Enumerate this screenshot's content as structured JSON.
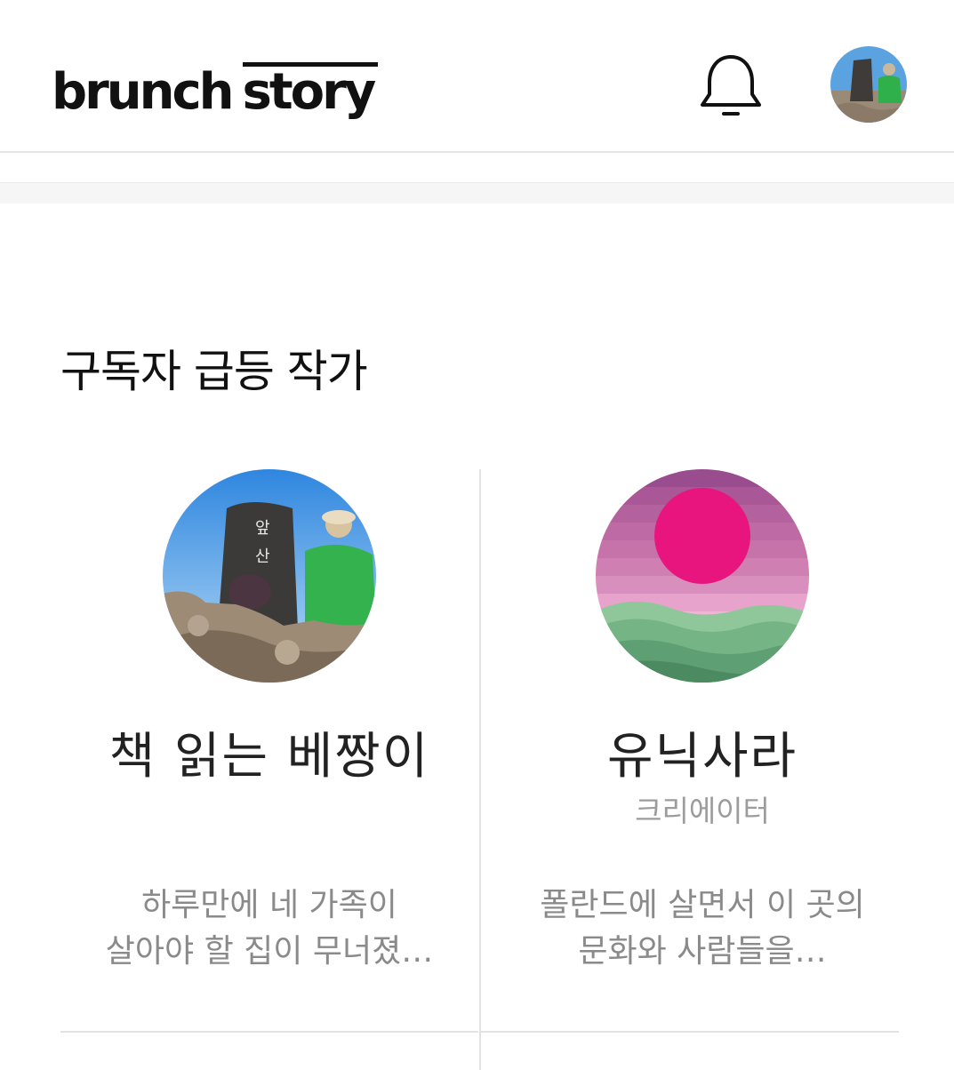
{
  "header": {
    "logo_brunch": "brunch",
    "logo_story": "story",
    "notifications_icon": "bell-icon",
    "profile_avatar": "user-avatar"
  },
  "section": {
    "title": "구독자 급등 작가"
  },
  "writers": [
    {
      "name": "책 읽는 베짱이",
      "role": "",
      "desc_line1": "하루만에 네 가족이",
      "desc_line2": "살아야 할 집이 무너졌…"
    },
    {
      "name": "유닉사라",
      "role": "크리에이터",
      "desc_line1": "폴란드에 살면서 이 곳의",
      "desc_line2": "문화와 사람들을…"
    }
  ],
  "colors": {
    "text_primary": "#111111",
    "text_secondary": "#8a8a8a",
    "role_gray": "#9c9c9c",
    "divider": "#e2e2e2",
    "sunset_pink": "#e8157f"
  }
}
